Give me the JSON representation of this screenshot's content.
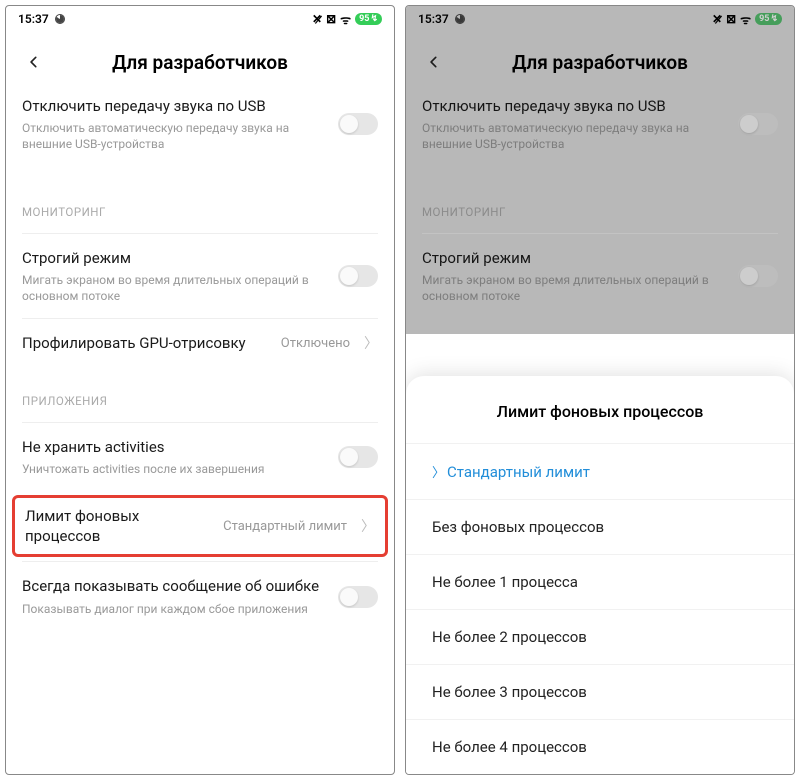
{
  "status": {
    "time": "15:37",
    "battery": "95",
    "bolt": "↯"
  },
  "header": {
    "title": "Для разработчиков"
  },
  "rows": {
    "usb_audio": {
      "title": "Отключить передачу звука по USB",
      "sub": "Отключить автоматическую передачу звука на внешние USB-устройства"
    },
    "section_monitoring": "МОНИТОРИНГ",
    "strict": {
      "title": "Строгий режим",
      "sub": "Мигать экраном во время длительных операций в основном потоке"
    },
    "gpu": {
      "title": "Профилировать GPU-отрисовку",
      "value": "Отключено"
    },
    "section_apps": "ПРИЛОЖЕНИЯ",
    "activities": {
      "title": "Не хранить activities",
      "sub": "Уничтожать activities после их завершения"
    },
    "bg_limit": {
      "title": "Лимит фоновых процессов",
      "value": "Стандартный лимит"
    },
    "crash": {
      "title": "Всегда показывать сообщение об ошибке",
      "sub": "Показывать диалог при каждом сбое приложения"
    }
  },
  "sheet": {
    "title": "Лимит фоновых процессов",
    "opt0": "Стандартный лимит",
    "opt1": "Без фоновых процессов",
    "opt2": "Не более 1 процесса",
    "opt3": "Не более 2 процессов",
    "opt4": "Не более 3 процессов",
    "opt5": "Не более 4 процессов"
  }
}
